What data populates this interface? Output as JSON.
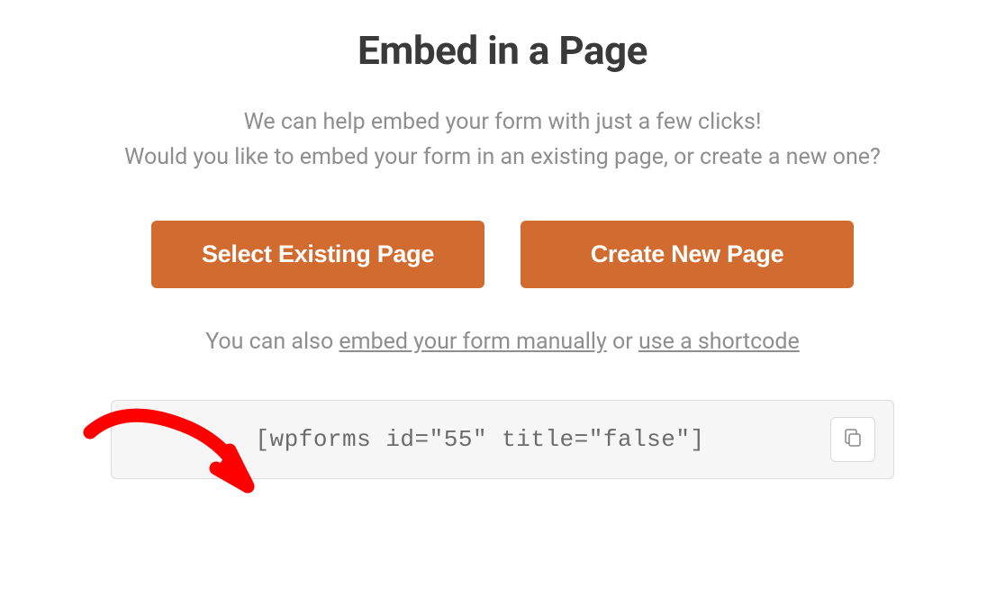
{
  "title": "Embed in a Page",
  "description_line1": "We can help embed your form with just a few clicks!",
  "description_line2": "Would you like to embed your form in an existing page, or create a new one?",
  "buttons": {
    "select_existing": "Select Existing Page",
    "create_new": "Create New Page"
  },
  "helper": {
    "prefix": "You can also ",
    "link_manual": "embed your form manually",
    "middle": " or ",
    "link_shortcode": "use a shortcode"
  },
  "shortcode": "[wpforms id=\"55\" title=\"false\"]",
  "colors": {
    "accent": "#d16b2f",
    "text_dark": "#3a3a3a",
    "text_muted": "#8e8e8e"
  }
}
